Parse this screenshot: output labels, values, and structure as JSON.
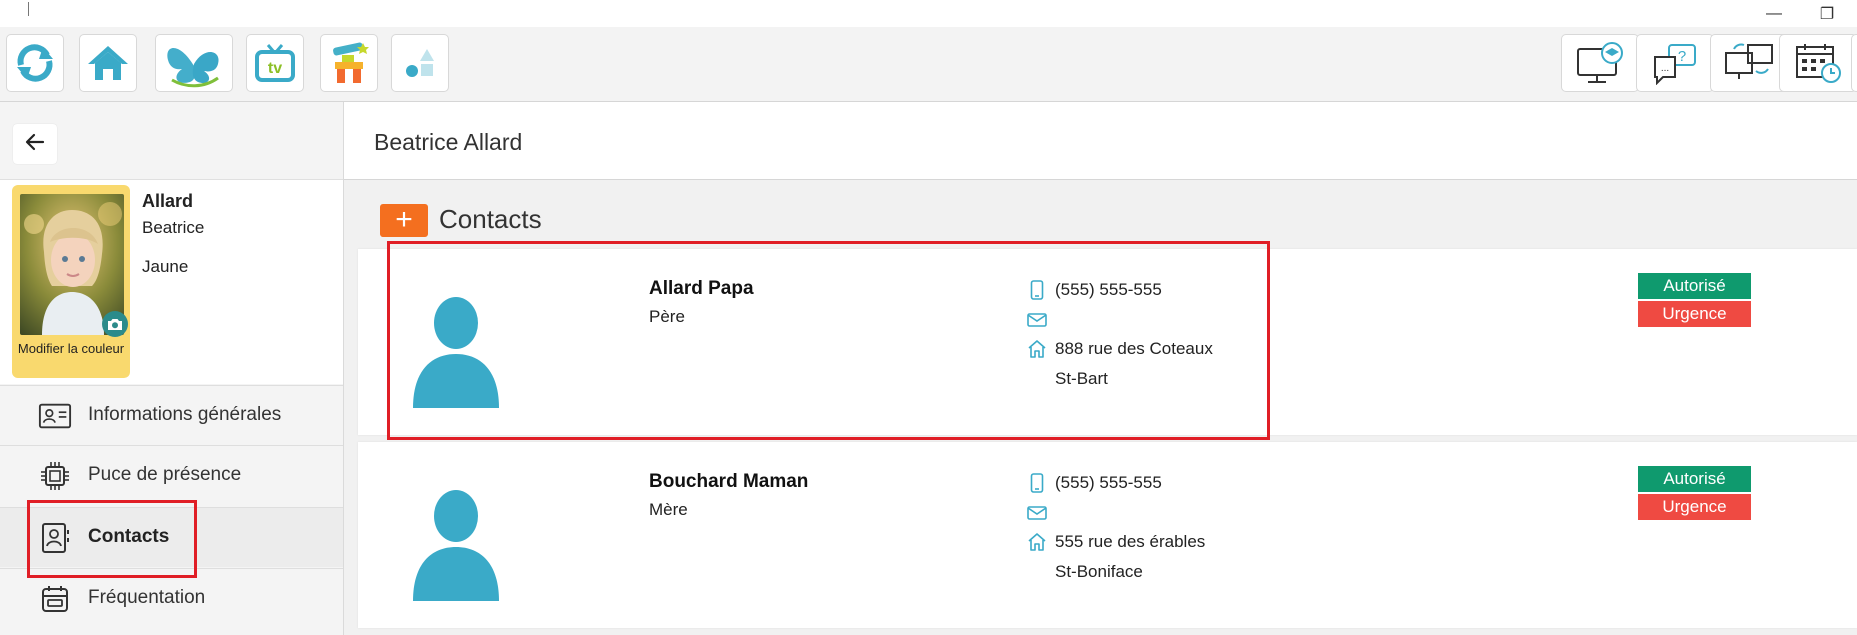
{
  "titlebar": {
    "minimize_glyph": "—",
    "restore_glyph": "❐"
  },
  "toolbar": {
    "left_buttons": [
      "refresh-icon",
      "home-icon",
      "butterfly-logo-icon",
      "tv-icon",
      "inukshuk-icon",
      "shapes-icon"
    ],
    "right_buttons": [
      "monitor-graduation-icon",
      "help-chat-icon",
      "screen-sync-icon",
      "calendar-clock-icon"
    ]
  },
  "sidebar": {
    "back_icon": "arrow-left-icon",
    "profile": {
      "last_name": "Allard",
      "first_name": "Beatrice",
      "group": "Jaune",
      "photo_caption": "Modifier la couleur",
      "card_color": "#f9d96e"
    },
    "nav": [
      {
        "label": "Informations générales",
        "icon": "id-card-icon"
      },
      {
        "label": "Puce de présence",
        "icon": "chip-icon"
      },
      {
        "label": "Contacts",
        "icon": "contact-book-icon",
        "active": true
      },
      {
        "label": "Fréquentation",
        "icon": "calendar-icon"
      }
    ]
  },
  "main": {
    "title": "Beatrice Allard",
    "add_label": "+",
    "section_title": "Contacts",
    "contacts": [
      {
        "name": "Allard Papa",
        "relation": "Père",
        "phone": "(555) 555-555",
        "email": "",
        "address_line1": "888 rue des Coteaux",
        "address_line2": "St-Bart",
        "badges": [
          "Autorisé",
          "Urgence"
        ],
        "highlighted": true
      },
      {
        "name": "Bouchard Maman",
        "relation": "Mère",
        "phone": "(555) 555-555",
        "email": "",
        "address_line1": "555 rue des érables",
        "address_line2": "St-Boniface",
        "badges": [
          "Autorisé",
          "Urgence"
        ],
        "highlighted": false
      }
    ]
  },
  "colors": {
    "accent_teal": "#3aaac8",
    "add_orange": "#f46f1f",
    "authorized_green": "#0f9a6e",
    "emergency_red": "#ef4a42",
    "highlight_red": "#e01e26"
  }
}
